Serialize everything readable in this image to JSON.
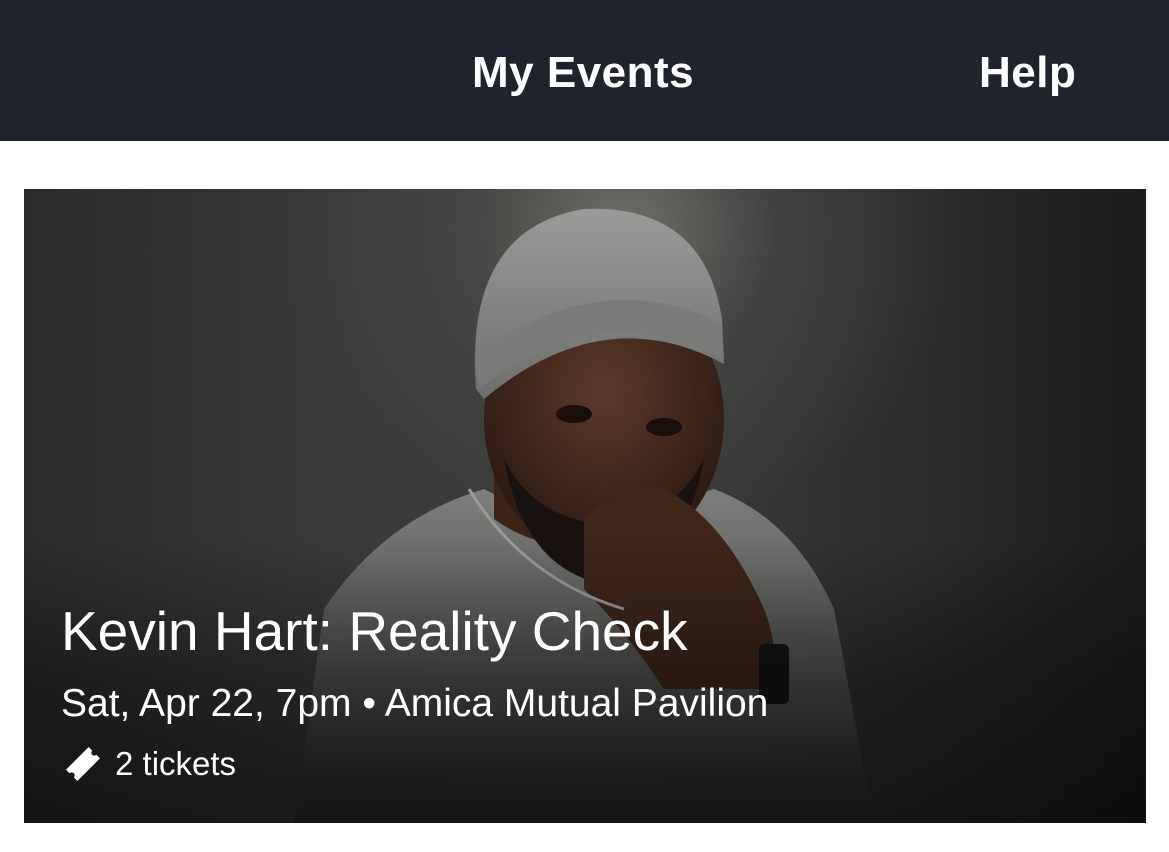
{
  "nav": {
    "my_events_label": "My Events",
    "help_label": "Help"
  },
  "event": {
    "title": "Kevin Hart: Reality Check",
    "date_time": "Sat, Apr 22, 7pm",
    "separator": "•",
    "venue": "Amica Mutual Pavilion",
    "tickets_label": "2 tickets",
    "ticket_icon": "ticket-icon"
  },
  "colors": {
    "topbar": "#1f232b",
    "text_light": "#ffffff",
    "page_bg": "#ffffff"
  }
}
